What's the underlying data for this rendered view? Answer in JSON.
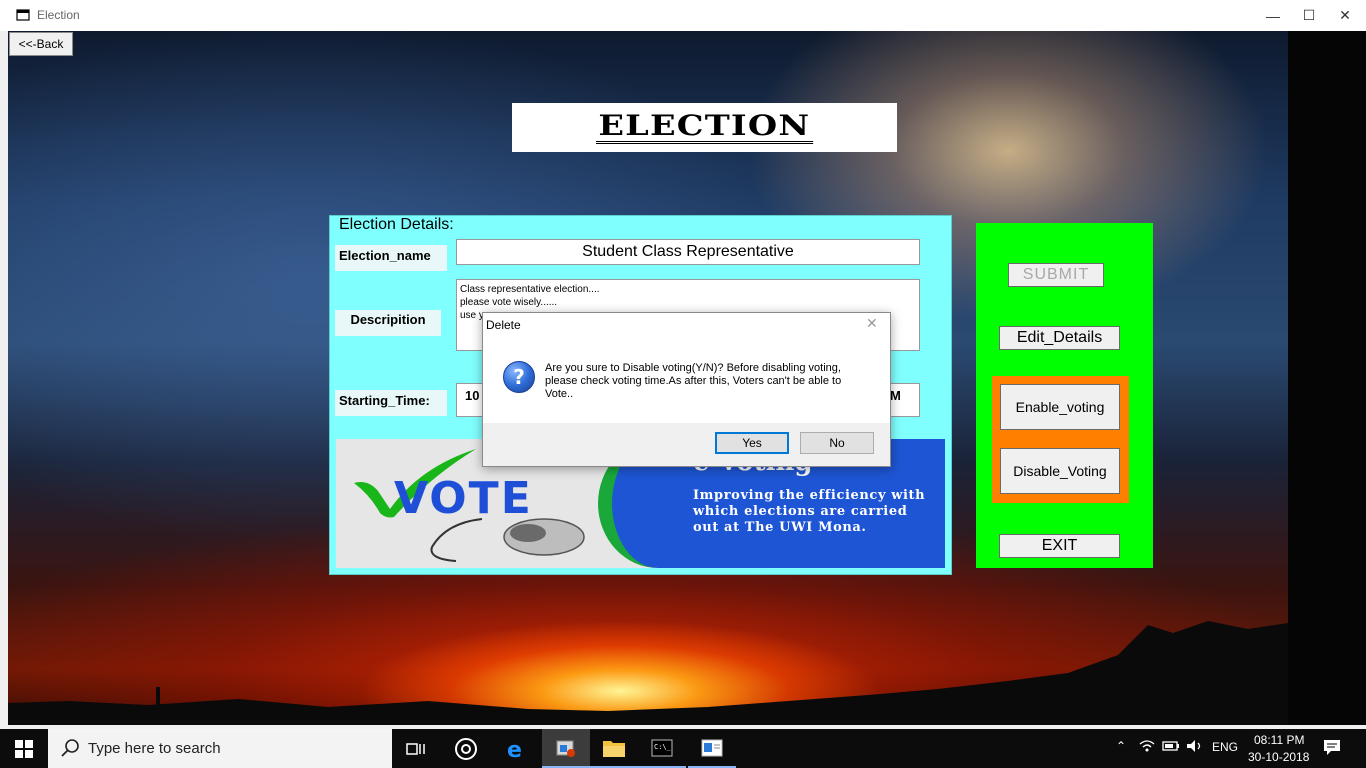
{
  "window": {
    "title": "Election",
    "back_label": "<<-Back"
  },
  "header": {
    "title": "ELECTION"
  },
  "details": {
    "legend": "Election  Details:",
    "name_label": "Election_name",
    "name_value": "Student Class Representative",
    "description_label": "Descripition",
    "description_lines": [
      "Class representative election....",
      "please vote wisely......",
      "use y"
    ],
    "start_label": "Starting_Time:",
    "start_value_left": "10",
    "start_value_right": "M"
  },
  "banner": {
    "vote_word": "VOTE",
    "line1": "e-Voting",
    "text": "Improving the efficiency with which elections are carried out at The UWI Mona."
  },
  "controls": {
    "submit": "SUBMIT",
    "edit": "Edit_Details",
    "enable": "Enable_voting",
    "disable": "Disable_Voting",
    "exit": "EXIT"
  },
  "dialog": {
    "title": "Delete",
    "message": "Are you sure to Disable voting(Y/N)? Before disabling voting, please check voting time.As after this, Voters can't be able to Vote..",
    "yes": "Yes",
    "no": "No",
    "icon": "question-icon"
  },
  "taskbar": {
    "search_placeholder": "Type here to search",
    "language": "ENG",
    "time": "08:11 PM",
    "date": "30-10-2018"
  },
  "colors": {
    "panel_cyan": "#80ffff",
    "controls_green": "#00ff00",
    "orange_frame": "#ff8000",
    "banner_blue": "#1e55d4"
  }
}
